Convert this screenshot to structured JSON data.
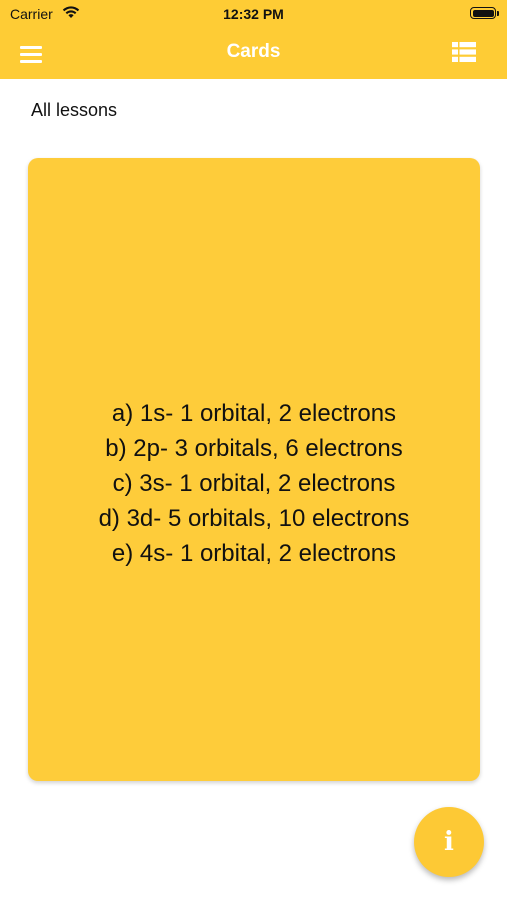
{
  "status_bar": {
    "carrier": "Carrier",
    "time": "12:32 PM"
  },
  "nav": {
    "title": "Cards",
    "left_icon": "hamburger-menu-icon",
    "right_icon": "list-view-icon",
    "bar_color": "#fecc35"
  },
  "lesson_filter": {
    "label": "All lessons"
  },
  "card": {
    "color": "#fecc3a",
    "lines": [
      "a) 1s- 1 orbital, 2 electrons",
      "b) 2p- 3 orbitals, 6 electrons",
      "c) 3s- 1 orbital, 2 electrons",
      "d) 3d- 5 orbitals, 10 electrons",
      "e) 4s- 1 orbital, 2 electrons"
    ]
  },
  "fab": {
    "glyph": "i",
    "icon": "info-icon"
  }
}
